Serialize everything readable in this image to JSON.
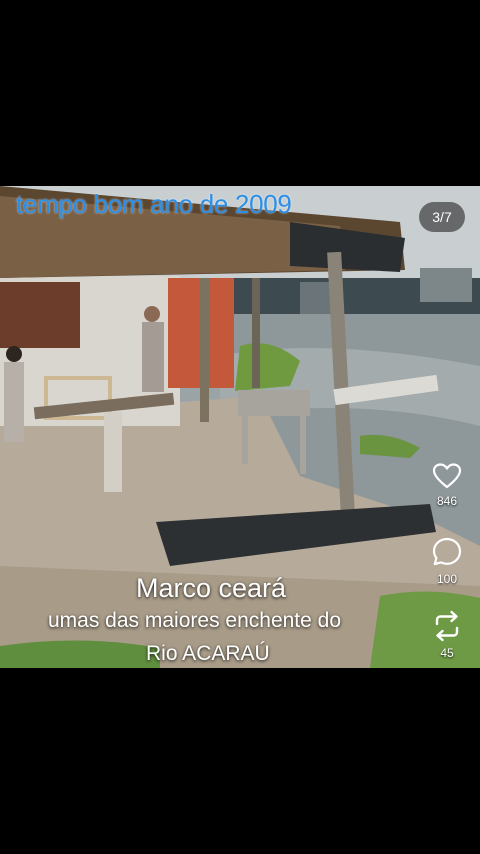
{
  "post": {
    "top_caption": "tempo bom ano de 2009",
    "counter": "3/7",
    "overlay_title": "Marco ceará",
    "overlay_line2": "umas das maiores enchente do",
    "overlay_line3": "Rio ACARAÚ"
  },
  "actions": {
    "like": {
      "icon": "heart-icon",
      "count": "846"
    },
    "comment": {
      "icon": "comment-icon",
      "count": "100"
    },
    "repost": {
      "icon": "repost-icon",
      "count": "45"
    }
  },
  "colors": {
    "background": "#000000",
    "caption_blue": "#2b8fe8",
    "text_white": "#ffffff"
  }
}
